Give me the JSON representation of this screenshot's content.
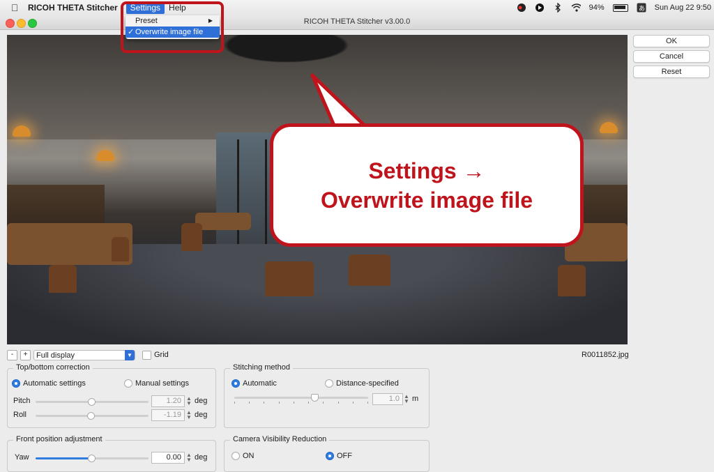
{
  "menubar": {
    "app_name": "RICOH THETA Stitcher",
    "menus": [
      "Settings",
      "Help"
    ],
    "status": {
      "battery": "94%",
      "datetime": "Sun Aug 22  9:50"
    }
  },
  "window": {
    "title": "RICOH THETA Stitcher v3.00.0"
  },
  "dropdown": {
    "items": [
      {
        "label": "Preset"
      },
      {
        "label": "Overwrite image file",
        "check": "✓"
      }
    ]
  },
  "callout": {
    "line1": "Settings →",
    "line2": "Overwrite image file"
  },
  "buttons": {
    "ok": "OK",
    "cancel": "Cancel",
    "reset": "Reset"
  },
  "toolbar": {
    "minus": "-",
    "plus": "+",
    "display_mode": "Full display",
    "grid": "Grid"
  },
  "filename": "R0011852.jpg",
  "top_bottom": {
    "title": "Top/bottom correction",
    "auto": "Automatic settings",
    "manual": "Manual settings",
    "pitch_label": "Pitch",
    "pitch_value": "1.20",
    "roll_label": "Roll",
    "roll_value": "-1.19",
    "unit": "deg"
  },
  "stitching": {
    "title": "Stitching method",
    "auto": "Automatic",
    "distance": "Distance-specified",
    "distance_value": "1.0",
    "unit": "m"
  },
  "front": {
    "title": "Front position adjustment",
    "yaw_label": "Yaw",
    "yaw_value": "0.00",
    "unit": "deg"
  },
  "camera_vis": {
    "title": "Camera Visibility Reduction",
    "on": "ON",
    "off": "OFF"
  },
  "colors": {
    "accent": "#2f6fd8",
    "callout_red": "#c0141d"
  }
}
